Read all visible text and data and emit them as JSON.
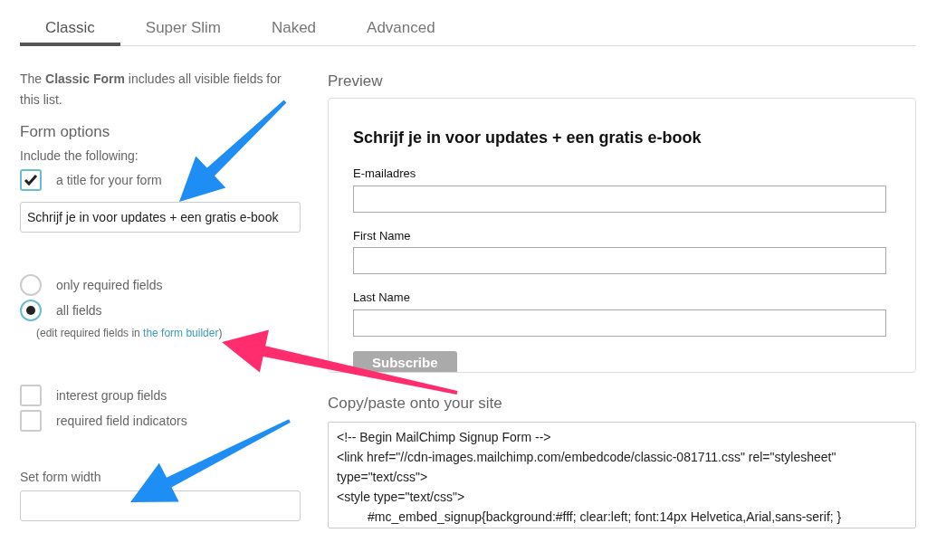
{
  "tabs": [
    {
      "label": "Classic",
      "selected": true
    },
    {
      "label": "Super Slim",
      "selected": false
    },
    {
      "label": "Naked",
      "selected": false
    },
    {
      "label": "Advanced",
      "selected": false
    }
  ],
  "intro": "The **Classic Form** includes all visible fields for this list.",
  "form_options": {
    "heading": "Form options",
    "include_label": "Include the following:",
    "title_option": {
      "label": "a title for your form",
      "checked": true
    },
    "title_field": {
      "value": "Schrijf je in voor updates + een gratis e-book"
    },
    "radios": [
      {
        "label": "only required fields",
        "selected": false
      },
      {
        "label": "all fields",
        "selected": true
      }
    ],
    "hint": {
      "before": "(edit required fields in ",
      "link": "the form builder",
      "after": ")"
    },
    "checkboxes": [
      {
        "label": "interest group fields",
        "checked": false
      },
      {
        "label": "required field indicators",
        "checked": false
      }
    ],
    "width_label": "Set form width"
  },
  "preview": {
    "heading": "Preview",
    "form_title": "Schrijf je in voor updates + een gratis e-book",
    "fields": [
      "E-mailadres",
      "First Name",
      "Last Name"
    ],
    "button": "Subscribe"
  },
  "embed": {
    "heading": "Copy/paste onto your site",
    "code_lines": [
      {
        "text": "<!-- Begin MailChimp Signup Form -->",
        "indented": false
      },
      {
        "text": "<link href=\"//cdn-images.mailchimp.com/embedcode/classic-081711.css\" rel=\"stylesheet\" type=\"text/css\">",
        "indented": false
      },
      {
        "text": "<style type=\"text/css\">",
        "indented": false
      },
      {
        "text": "#mc_embed_signup{background:#fff; clear:left; font:14px Helvetica,Arial,sans-serif; }",
        "indented": true
      }
    ]
  }
}
